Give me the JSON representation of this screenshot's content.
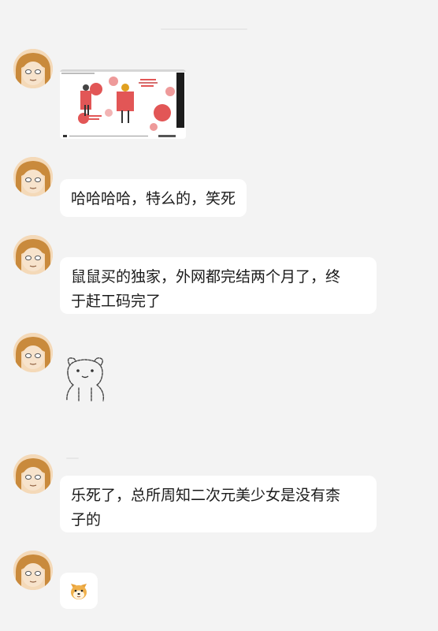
{
  "messages": [
    {
      "type": "video",
      "title_text": "...",
      "duration": "...",
      "avatar_icon": "cartoon-girl-avatar"
    },
    {
      "type": "text",
      "text": "哈哈哈哈，特么的，笑死"
    },
    {
      "type": "text",
      "text": "鼠鼠买的独家，外网都完结两个月了，终\n于赶工码完了"
    },
    {
      "type": "sticker",
      "sticker_icon": "bear-sticker-icon"
    },
    {
      "type": "text",
      "text": "乐死了，总所周知二次元美少女是没有柰\n子的"
    },
    {
      "type": "emoji",
      "emoji_icon": "shiba-dog-emoji-icon"
    }
  ],
  "colors": {
    "background": "#f3f3f3",
    "bubble": "#ffffff",
    "text": "#1b1b1b",
    "accent_red": "#e25656"
  }
}
